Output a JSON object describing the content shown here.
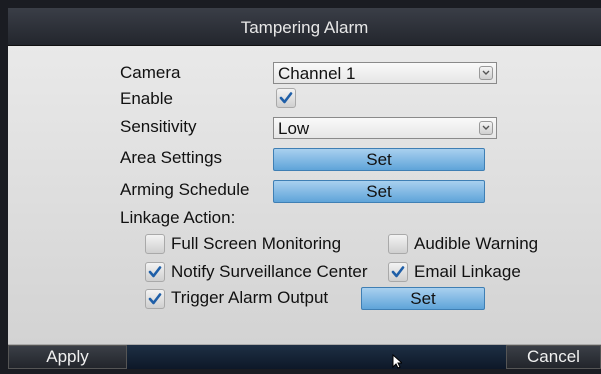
{
  "dialog": {
    "title": "Tampering Alarm"
  },
  "fields": {
    "camera_label": "Camera",
    "camera_value": "Channel 1",
    "enable_label": "Enable",
    "enable_checked": true,
    "sensitivity_label": "Sensitivity",
    "sensitivity_value": "Low",
    "area_label": "Area Settings",
    "area_button": "Set",
    "schedule_label": "Arming Schedule",
    "schedule_button": "Set",
    "linkage_label": "Linkage Action:"
  },
  "linkage": {
    "full_screen": {
      "label": "Full Screen Monitoring",
      "checked": false
    },
    "audible": {
      "label": "Audible Warning",
      "checked": false
    },
    "notify_center": {
      "label": "Notify Surveillance Center",
      "checked": true
    },
    "email": {
      "label": "Email Linkage",
      "checked": true
    },
    "trigger_output": {
      "label": "Trigger Alarm Output",
      "checked": true
    },
    "trigger_set_button": "Set"
  },
  "footer": {
    "apply": "Apply",
    "cancel": "Cancel"
  },
  "colors": {
    "accent_blue": "#5fa4d9",
    "check_blue": "#1f5fa8"
  }
}
